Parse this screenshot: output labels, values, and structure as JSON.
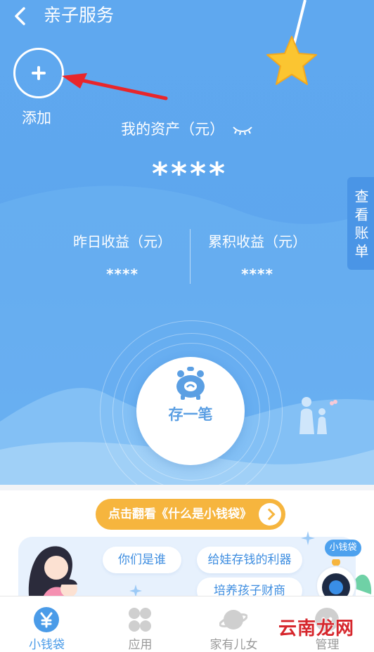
{
  "header": {
    "title": "亲子服务"
  },
  "add": {
    "label": "添加"
  },
  "assets": {
    "label": "我的资产（元）",
    "value": "****"
  },
  "bill": {
    "label": "查看账单"
  },
  "earnings": [
    {
      "label": "昨日收益（元）",
      "value": "****"
    },
    {
      "label": "累积收益（元）",
      "value": "****"
    }
  ],
  "save": {
    "label": "存一笔"
  },
  "banner": {
    "text": "点击翻看《什么是小钱袋》"
  },
  "promo": {
    "tags": [
      "你们是谁",
      "给娃存钱的利器",
      "培养孩子财商"
    ],
    "mascot_label": "小钱袋"
  },
  "tabs": [
    {
      "label": "小钱袋",
      "icon": "yen-icon",
      "active": true
    },
    {
      "label": "应用",
      "icon": "apps-icon",
      "active": false
    },
    {
      "label": "家有儿女",
      "icon": "planet-icon",
      "active": false
    },
    {
      "label": "管理",
      "icon": "manage-icon",
      "active": false
    }
  ],
  "watermark": "云南龙网",
  "colors": {
    "primary": "#5ea6ee",
    "accent": "#f6b53e",
    "arrow": "#e8262b"
  }
}
